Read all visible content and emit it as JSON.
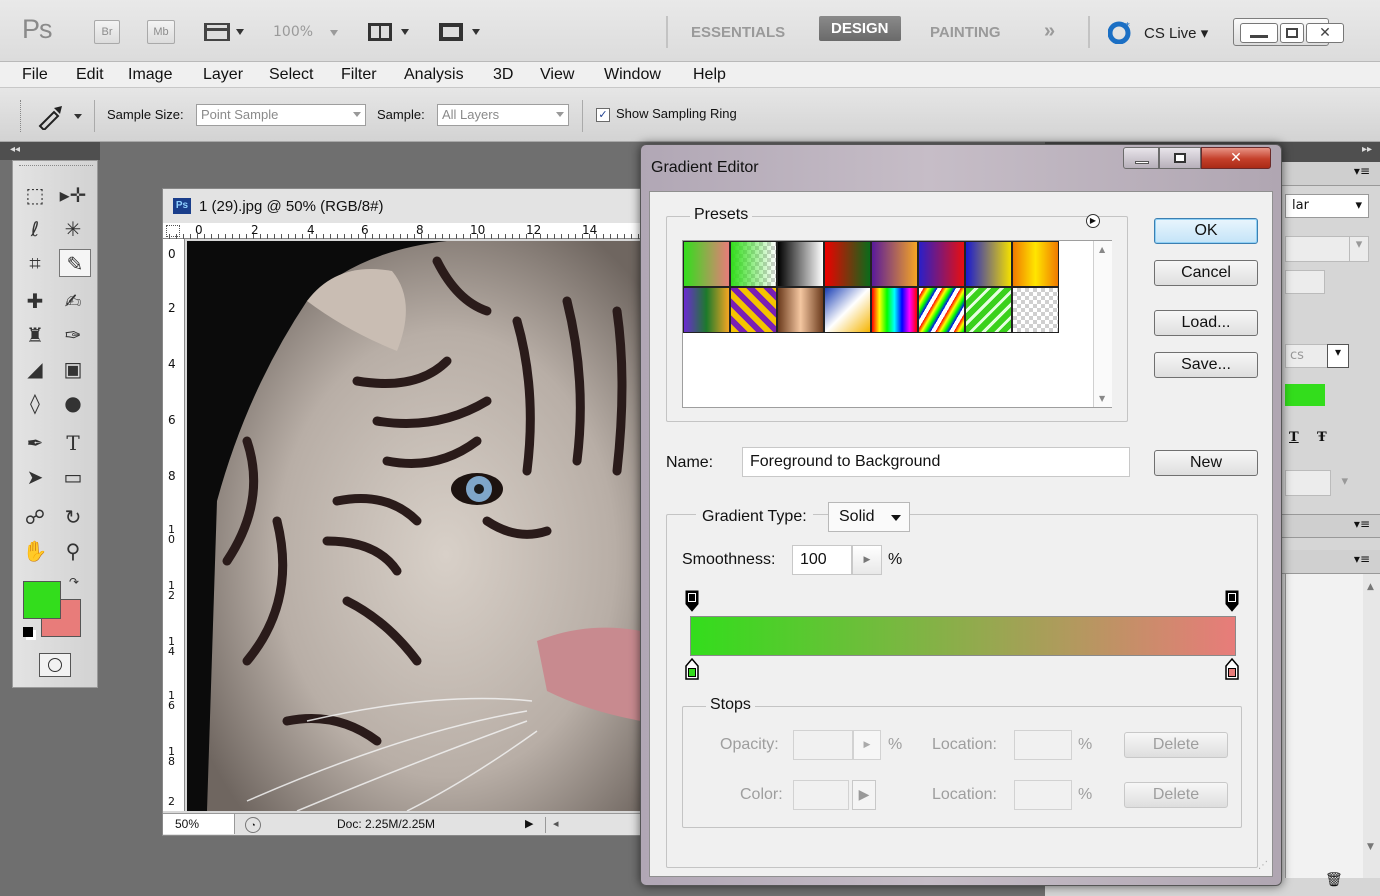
{
  "app": {
    "logo": "Ps",
    "bridge": "Br",
    "minibridge": "Mb",
    "zoom": "100%",
    "workspaces": [
      "ESSENTIALS",
      "DESIGN",
      "PAINTING"
    ],
    "active_workspace": "DESIGN",
    "overflow": "»",
    "cs_live": "CS Live ▾"
  },
  "menu": [
    "File",
    "Edit",
    "Image",
    "Layer",
    "Select",
    "Filter",
    "Analysis",
    "3D",
    "View",
    "Window",
    "Help"
  ],
  "options": {
    "sample_size_label": "Sample Size:",
    "sample_size_value": "Point Sample",
    "sample_label": "Sample:",
    "sample_value": "All Layers",
    "ring_label": "Show Sampling Ring",
    "ring_checked": true
  },
  "colors": {
    "foreground": "#33dd1c",
    "background": "#e87c7a",
    "accent": "#3c7fb1"
  },
  "document": {
    "title": "1 (29).jpg @ 50% (RGB/8#)",
    "ruler_top": [
      "0",
      "2",
      "4",
      "6",
      "8",
      "10",
      "12",
      "14"
    ],
    "ruler_left": [
      "0",
      "2",
      "4",
      "6",
      "8",
      "10",
      "12",
      "14",
      "16",
      "18",
      "2"
    ],
    "zoom": "50%",
    "doc_size": "Doc: 2.25M/2.25M"
  },
  "panel": {
    "dropdown1": "lar",
    "dropdown2": "cs",
    "text_t": "T",
    "text_strike": "Ŧ"
  },
  "dialog": {
    "title": "Gradient Editor",
    "presets_label": "Presets",
    "ok": "OK",
    "cancel": "Cancel",
    "load": "Load...",
    "save": "Save...",
    "new": "New",
    "name_label": "Name:",
    "name_value": "Foreground to Background",
    "gradient_type_label": "Gradient Type:",
    "gradient_type_value": "Solid",
    "smoothness_label": "Smoothness:",
    "smoothness_value": "100",
    "percent": "%",
    "stops_label": "Stops",
    "opacity_label": "Opacity:",
    "color_label": "Color:",
    "location_label": "Location:",
    "delete": "Delete"
  }
}
